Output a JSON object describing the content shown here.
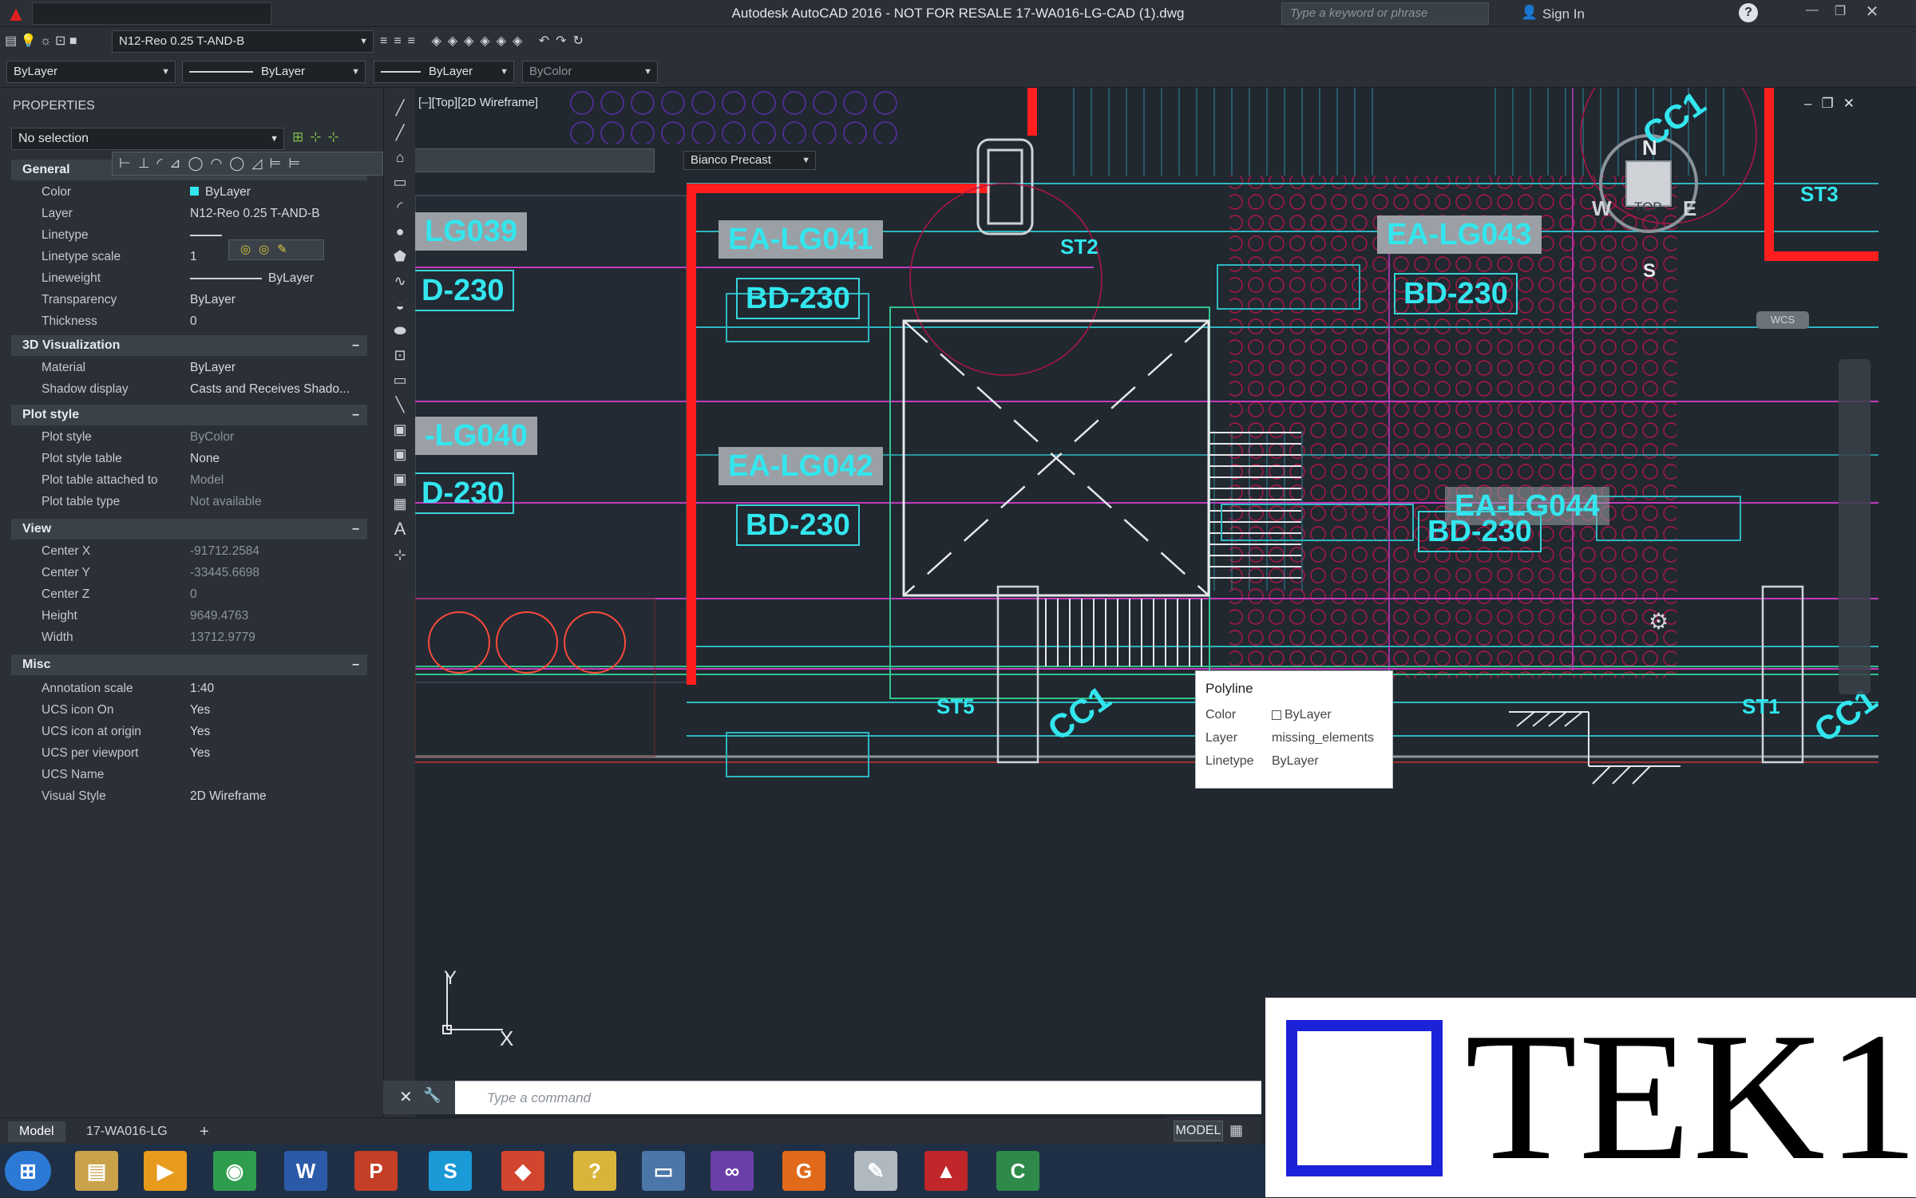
{
  "titlebar": {
    "title": "Autodesk AutoCAD 2016 - NOT FOR RESALE    17-WA016-LG-CAD (1).dwg",
    "search_placeholder": "Type a keyword or phrase",
    "sign_in": "Sign In"
  },
  "layer_toolbar": {
    "layer_value": "N12-Reo 0.25 T-AND-B"
  },
  "properties_toolbar": {
    "color": "ByLayer",
    "linetype": "ByLayer",
    "lineweight": "ByLayer",
    "plotstyle": "ByColor",
    "material": "Bianco Precast"
  },
  "properties": {
    "panel_title": "PROPERTIES",
    "selection": "No selection",
    "sections": [
      {
        "title": "General",
        "rows": [
          {
            "k": "Color",
            "v": "ByLayer"
          },
          {
            "k": "Layer",
            "v": "N12-Reo 0.25 T-AND-B"
          },
          {
            "k": "Linetype",
            "v": ""
          },
          {
            "k": "Linetype scale",
            "v": "1"
          },
          {
            "k": "Lineweight",
            "v": "ByLayer"
          },
          {
            "k": "Transparency",
            "v": "ByLayer"
          },
          {
            "k": "Thickness",
            "v": "0"
          }
        ]
      },
      {
        "title": "3D Visualization",
        "rows": [
          {
            "k": "Material",
            "v": "ByLayer"
          },
          {
            "k": "Shadow display",
            "v": "Casts and Receives Shado..."
          }
        ]
      },
      {
        "title": "Plot style",
        "rows": [
          {
            "k": "Plot style",
            "v": "ByColor"
          },
          {
            "k": "Plot style table",
            "v": "None"
          },
          {
            "k": "Plot table attached to",
            "v": "Model"
          },
          {
            "k": "Plot table type",
            "v": "Not available"
          }
        ]
      },
      {
        "title": "View",
        "rows": [
          {
            "k": "Center X",
            "v": "-91712.2584"
          },
          {
            "k": "Center Y",
            "v": "-33445.6698"
          },
          {
            "k": "Center Z",
            "v": "0"
          },
          {
            "k": "Height",
            "v": "9649.4763"
          },
          {
            "k": "Width",
            "v": "13712.9779"
          }
        ]
      },
      {
        "title": "Misc",
        "rows": [
          {
            "k": "Annotation scale",
            "v": "1:40"
          },
          {
            "k": "UCS icon On",
            "v": "Yes"
          },
          {
            "k": "UCS icon at origin",
            "v": "Yes"
          },
          {
            "k": "UCS per viewport",
            "v": "Yes"
          },
          {
            "k": "UCS Name",
            "v": ""
          },
          {
            "k": "Visual Style",
            "v": "2D Wireframe"
          }
        ]
      }
    ]
  },
  "viewport": {
    "label": "[–][Top][2D Wireframe]",
    "tags": [
      "LG039",
      "EA-LG041",
      "EA-LG043",
      "-LG040",
      "EA-LG042",
      "EA-LG044"
    ],
    "boxes": [
      "D-230",
      "BD-230",
      "BD-230",
      "D-230",
      "BD-230",
      "BD-230"
    ],
    "stations": [
      "ST2",
      "ST3",
      "ST5",
      "ST1",
      "CC1",
      "CC1",
      "CC1"
    ],
    "viewcube": {
      "top": "TOP",
      "n": "N",
      "s": "S",
      "e": "E",
      "w": "W",
      "wcs": "WCS"
    },
    "ucs": {
      "x": "X",
      "y": "Y"
    }
  },
  "tooltip": {
    "title": "Polyline",
    "rows": [
      {
        "k": "Color",
        "v": "ByLayer"
      },
      {
        "k": "Layer",
        "v": "missing_elements"
      },
      {
        "k": "Linetype",
        "v": "ByLayer"
      }
    ]
  },
  "command": {
    "placeholder": "Type a command"
  },
  "layout_tabs": [
    "Model",
    "17-WA016-LG"
  ],
  "status": {
    "model": "MODEL"
  },
  "logo": {
    "text": "TEK1"
  },
  "colors": {
    "cyan": "#33e6ee",
    "red": "#ff1e1e",
    "magenta": "#c23cbf",
    "bg": "#212830"
  }
}
